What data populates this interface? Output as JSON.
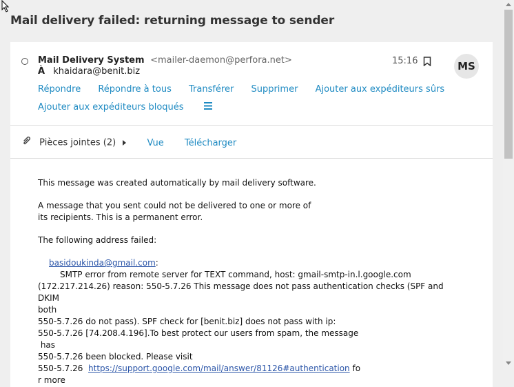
{
  "subject": "Mail delivery failed: returning message to sender",
  "header": {
    "from_name": "Mail Delivery System",
    "from_email": "<mailer-daemon@perfora.net>",
    "to_label": "À",
    "to_address": "khaidara@benit.biz",
    "time": "15:16",
    "avatar_initials": "MS"
  },
  "actions": {
    "reply": "Répondre",
    "reply_all": "Répondre à tous",
    "forward": "Transférer",
    "delete": "Supprimer",
    "add_safe": "Ajouter aux expéditeurs sûrs",
    "add_blocked": "Ajouter aux expéditeurs bloqués"
  },
  "attachments": {
    "label": "Pièces jointes (2)",
    "view": "Vue",
    "download": "Télécharger"
  },
  "body": {
    "line1": "This message was created automatically by mail delivery software.",
    "line2a": "A message that you sent could not be delivered to one or more of",
    "line2b": "its recipients. This is a permanent error.",
    "line3": "The following address failed:",
    "failed_address": "basidoukinda@gmail.com",
    "colon": ":",
    "smtp1": "SMTP error from remote server for TEXT command, host: gmail-smtp-in.l.google.com",
    "smtp2": "(172.217.214.26) reason: 550-5.7.26 This message does not pass authentication checks (SPF and DKIM",
    "smtp3": "both",
    "smtp4": "550-5.7.26 do not pass). SPF check for [benit.biz] does not pass with ip:",
    "smtp5": "550-5.7.26 [74.208.4.196].To best protect our users from spam, the message",
    "smtp6": " has",
    "smtp7": "550-5.7.26 been blocked. Please visit",
    "smtp8_prefix": "550-5.7.26  ",
    "smtp8_link": "https://support.google.com/mail/answer/81126#authentication",
    "smtp8_suffix": " fo",
    "smtp9": "r more"
  },
  "colors": {
    "link": "#1e8ac2",
    "body_link": "#2b55a8",
    "background": "#efefef"
  }
}
